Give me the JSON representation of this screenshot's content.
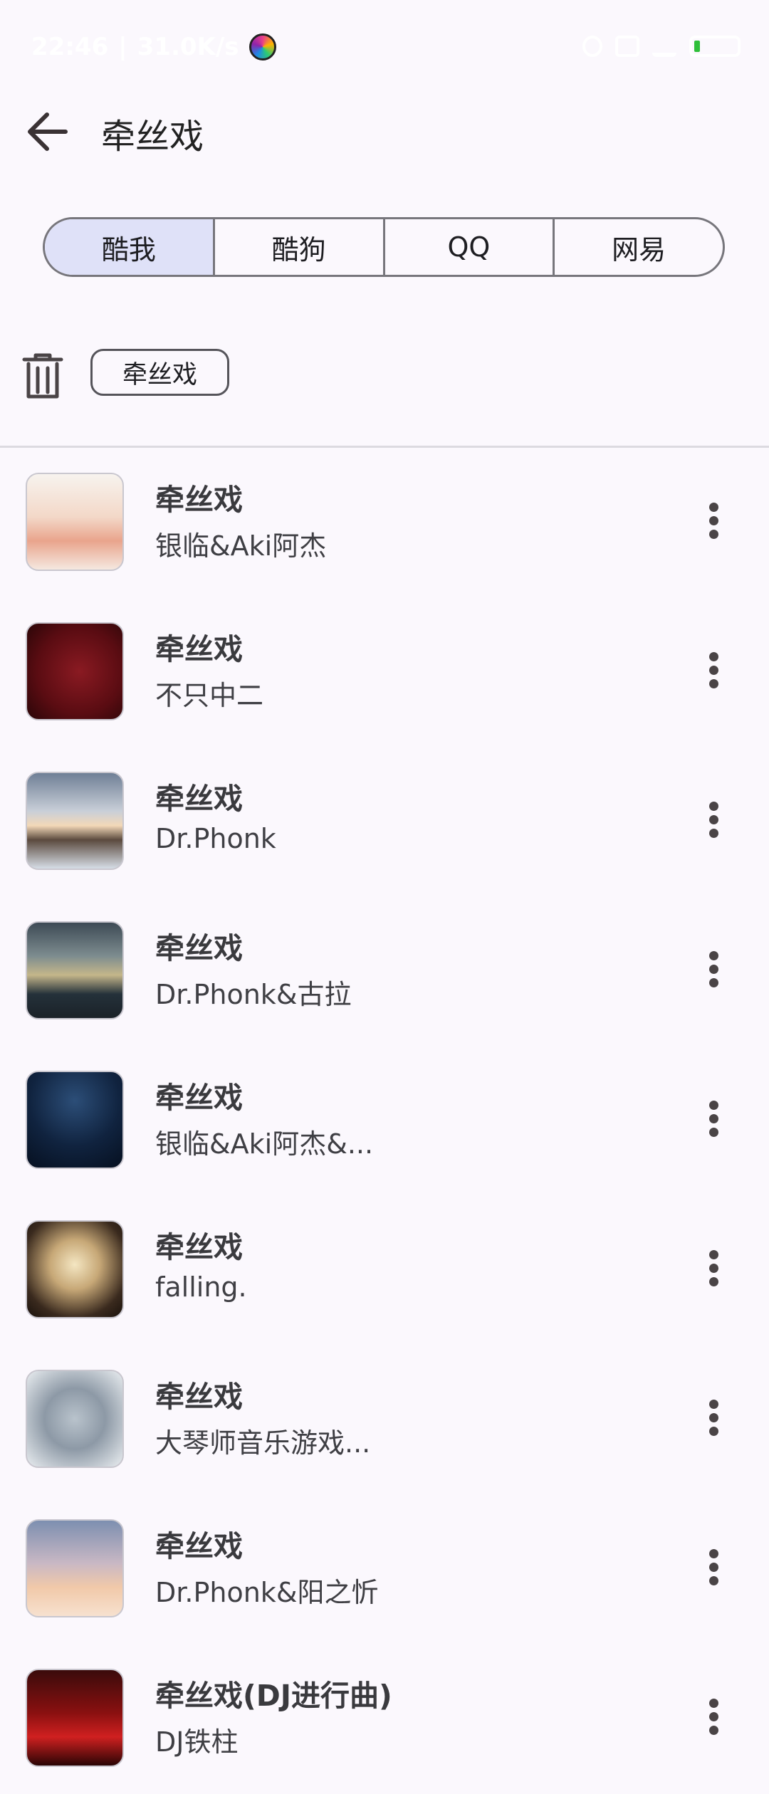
{
  "status": {
    "time": "22:46",
    "speed": "31.0K/s"
  },
  "header": {
    "title": "牵丝戏"
  },
  "tabs": [
    {
      "label": "酷我",
      "active": true
    },
    {
      "label": "酷狗",
      "active": false
    },
    {
      "label": "QQ",
      "active": false
    },
    {
      "label": "网易",
      "active": false
    }
  ],
  "history": {
    "chips": [
      "牵丝戏"
    ]
  },
  "songs": [
    {
      "title": "牵丝戏",
      "artist": "银临&Aki阿杰"
    },
    {
      "title": "牵丝戏",
      "artist": "不只中二"
    },
    {
      "title": "牵丝戏",
      "artist": "Dr.Phonk"
    },
    {
      "title": "牵丝戏",
      "artist": "Dr.Phonk&古拉"
    },
    {
      "title": "牵丝戏",
      "artist": "银临&Aki阿杰&..."
    },
    {
      "title": "牵丝戏",
      "artist": "falling."
    },
    {
      "title": "牵丝戏",
      "artist": "大琴师音乐游戏..."
    },
    {
      "title": "牵丝戏",
      "artist": "Dr.Phonk&阳之忻"
    },
    {
      "title": "牵丝戏(DJ进行曲)",
      "artist": "DJ铁柱"
    }
  ],
  "colors": {
    "accent": "#dfe1f8",
    "background": "#fbf8fd",
    "battery": "#2fbf3a"
  }
}
